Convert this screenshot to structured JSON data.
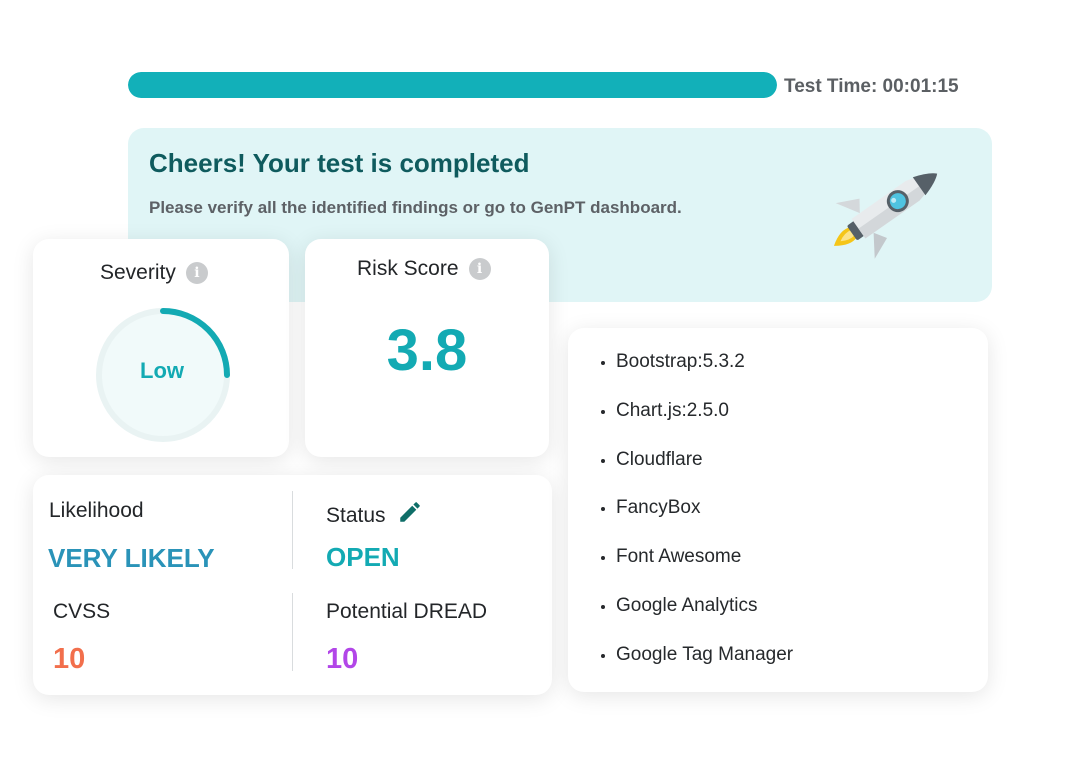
{
  "progress": {
    "fraction": 1.0,
    "color": "#12b0b9"
  },
  "test_time": "Test Time: 00:01:15",
  "banner": {
    "title": "Cheers! Your test is completed",
    "subtitle": "Please verify all the identified findings or go to GenPT dashboard.",
    "icon": "rocket-icon",
    "background": "#e0f5f6"
  },
  "severity": {
    "title": "Severity",
    "value": "Low",
    "gauge_fraction": 0.25,
    "info_glyph": "i"
  },
  "risk": {
    "title": "Risk Score",
    "value": "3.8",
    "info_glyph": "i"
  },
  "metrics": {
    "likelihood_label": "Likelihood",
    "likelihood_value": "VERY LIKELY",
    "status_label": "Status",
    "status_value": "OPEN",
    "cvss_label": "CVSS",
    "cvss_value": "10",
    "dread_label": "Potential DREAD",
    "dread_value": "10"
  },
  "colors": {
    "accent": "#13aab3",
    "likelihood": "#2a93b8",
    "cvss": "#f26f4c",
    "dread": "#b246e8",
    "title": "#0f5b5e"
  },
  "technologies": [
    "Bootstrap:5.3.2",
    "Chart.js:2.5.0",
    "Cloudflare",
    "FancyBox",
    "Font Awesome",
    "Google Analytics",
    "Google Tag Manager"
  ]
}
